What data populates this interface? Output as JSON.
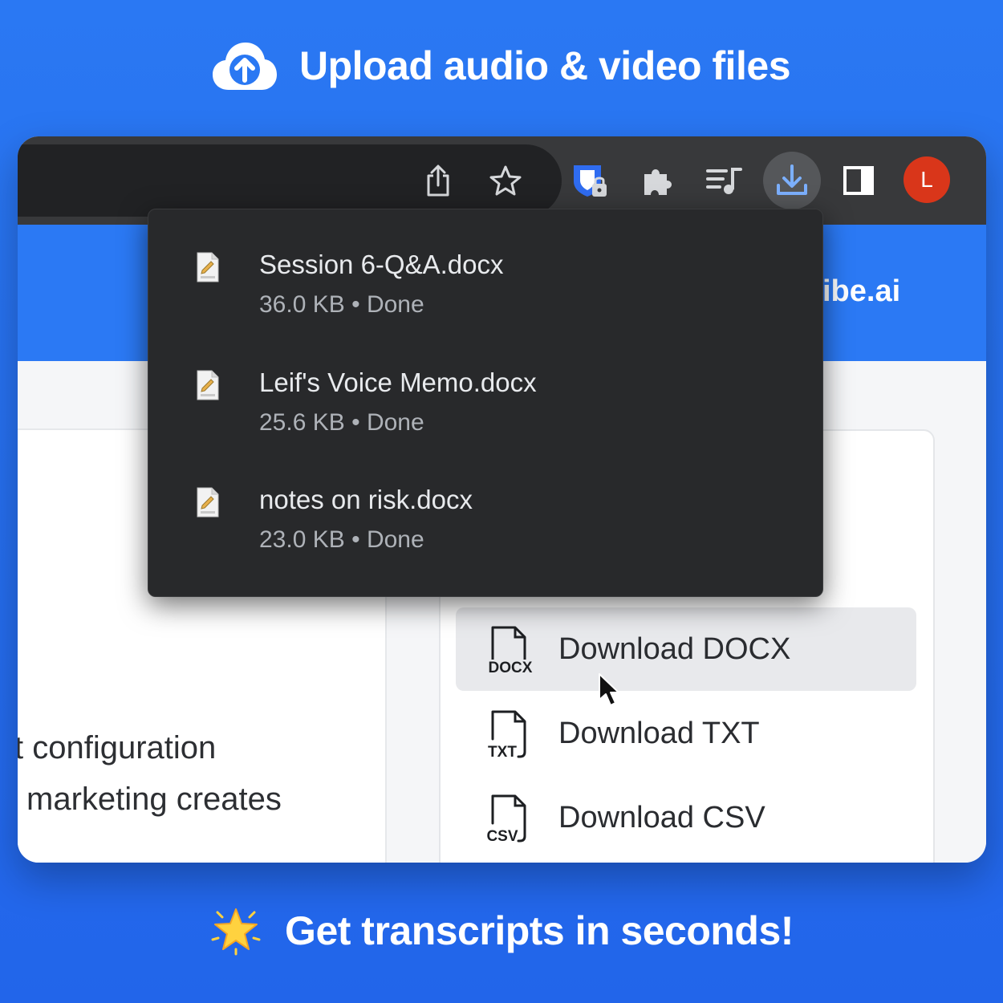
{
  "banner": {
    "top_text": "Upload audio & video files",
    "bottom_text": "Get transcripts in seconds!",
    "top_icon": "cloud-upload-icon",
    "bottom_icon": "star-icon"
  },
  "toolbar": {
    "icons": [
      "share-icon",
      "bookmark-star-icon",
      "password-manager-icon",
      "extensions-icon",
      "media-control-icon",
      "downloads-icon",
      "side-panel-icon"
    ],
    "avatar_initial": "L"
  },
  "site": {
    "partial_brand": "ibe.ai"
  },
  "downloads": [
    {
      "name": "Session 6-Q&A.docx",
      "size": "36.0 KB",
      "status": "Done"
    },
    {
      "name": "Leif's Voice Memo.docx",
      "size": "25.6 KB",
      "status": "Done"
    },
    {
      "name": "notes on risk.docx",
      "size": "23.0 KB",
      "status": "Done"
    }
  ],
  "page": {
    "left_line1": "t configuration",
    "left_line2": "marketing creates"
  },
  "export_menu": [
    {
      "label": "Download DOCX",
      "badge": "DOCX"
    },
    {
      "label": "Download TXT",
      "badge": "TXT"
    },
    {
      "label": "Download CSV",
      "badge": "CSV"
    }
  ],
  "colors": {
    "background": "#2a78f3",
    "toolbar": "#38393b",
    "avatar": "#d9361a",
    "popup": "#28292b"
  }
}
